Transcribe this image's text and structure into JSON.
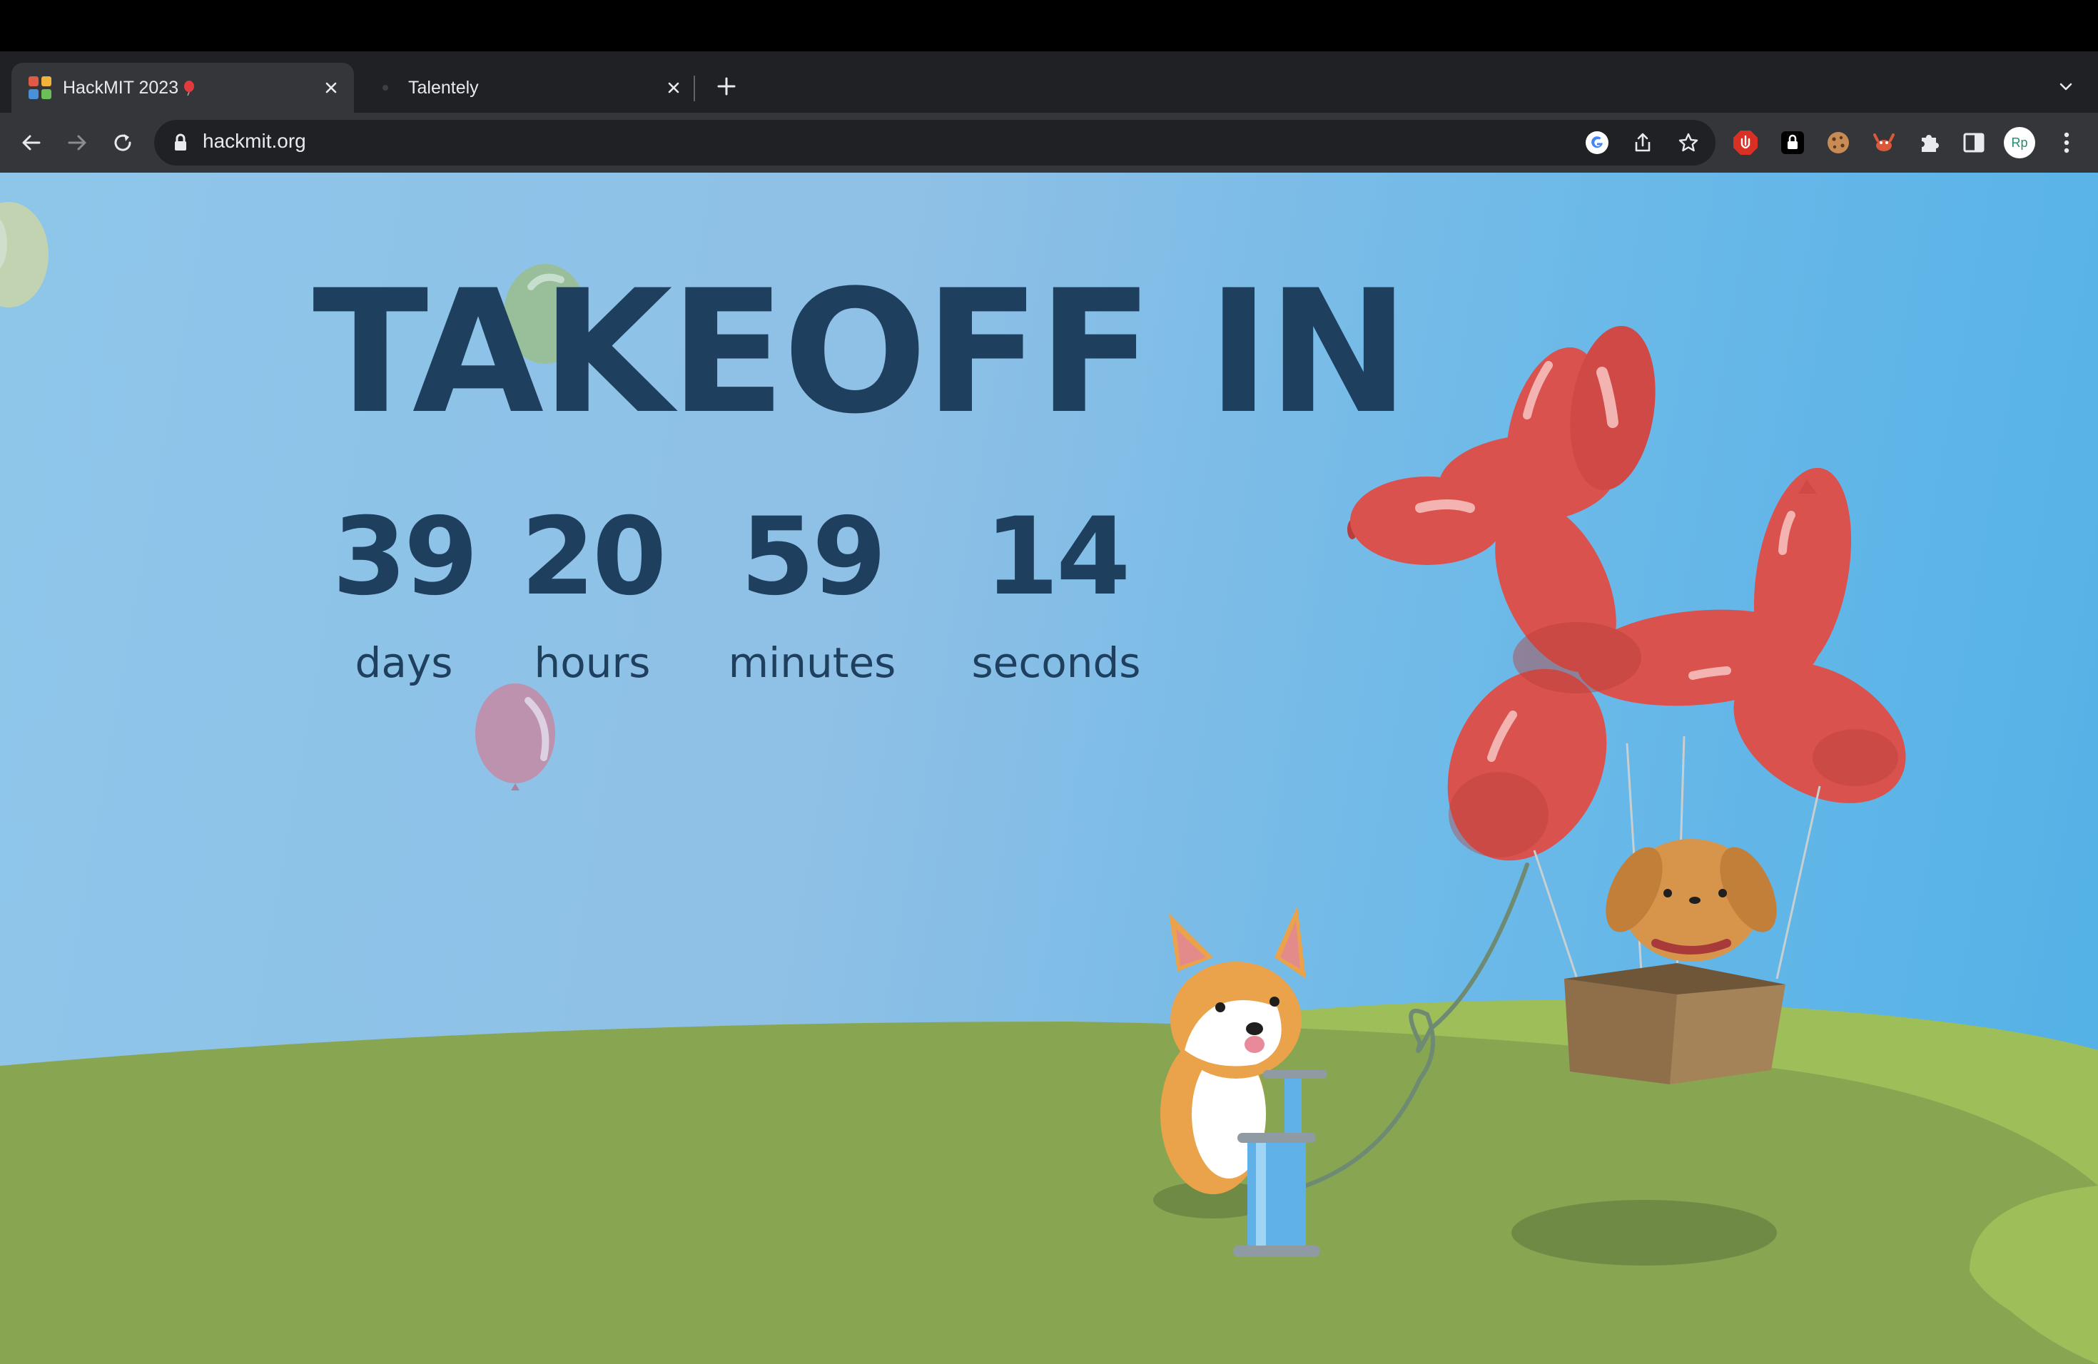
{
  "browser": {
    "tabs": [
      {
        "title": "HackMIT 2023",
        "active": true,
        "favicon": "hackmit-logo-icon"
      },
      {
        "title": "Talentely",
        "active": false,
        "favicon": "talentely-icon"
      }
    ],
    "url": "hackmit.org",
    "avatar_initials": "Rp",
    "omnibox_icons": [
      "google-icon",
      "share-icon",
      "bookmark-star-icon"
    ],
    "extensions": [
      "adblock-icon",
      "lock-extension-icon",
      "cookie-icon",
      "crab-extension-icon",
      "puzzle-icon",
      "side-panel-icon"
    ]
  },
  "page": {
    "headline": "TAKEOFF IN",
    "countdown": [
      {
        "value": "39",
        "label": "days"
      },
      {
        "value": "20",
        "label": "hours"
      },
      {
        "value": "59",
        "label": "minutes"
      },
      {
        "value": "14",
        "label": "seconds"
      }
    ],
    "colors": {
      "text": "#1f3f5e",
      "sky": "#8ec6ea",
      "grass": "#88a652",
      "balloon_dog": "#d9524e"
    }
  }
}
